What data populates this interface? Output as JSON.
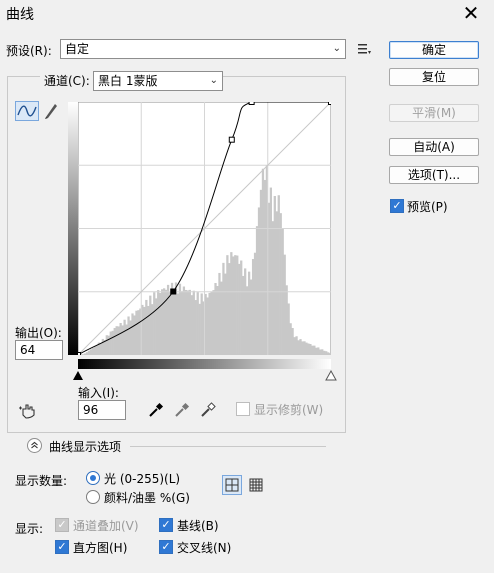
{
  "window": {
    "title": "曲线",
    "close_label": "✕"
  },
  "preset": {
    "label": "预设(R):",
    "value": "自定"
  },
  "channel": {
    "label": "通道(C):",
    "value": "黑白 1蒙版"
  },
  "buttons": {
    "ok": "确定",
    "reset": "复位",
    "smooth": "平滑(M)",
    "auto": "自动(A)",
    "options": "选项(T)..."
  },
  "preview": {
    "label": "预览(P)",
    "checked": true
  },
  "output": {
    "label": "输出(O):",
    "value": "64"
  },
  "input": {
    "label": "输入(I):",
    "value": "96"
  },
  "show_clipping": {
    "label": "显示修剪(W)",
    "checked": false
  },
  "curve_display": {
    "label": "曲线显示选项"
  },
  "show_amount": {
    "label": "显示数量:",
    "option_light": "光 (0-255)(L)",
    "option_pigment": "颜料/油墨 %(G)",
    "selected": "light"
  },
  "show": {
    "label": "显示:",
    "channel_overlays": "通道叠加(V)",
    "baseline": "基线(B)",
    "histogram": "直方图(H)",
    "intersection": "交叉线(N)"
  },
  "colors": {
    "accent": "#2f78d4",
    "histogram": "#c8c8c8",
    "grid": "#d6d6d6"
  },
  "curve_points": [
    {
      "input": 0,
      "output": 0
    },
    {
      "input": 96,
      "output": 64
    },
    {
      "input": 155,
      "output": 217
    },
    {
      "input": 175,
      "output": 255
    },
    {
      "input": 255,
      "output": 255
    }
  ]
}
